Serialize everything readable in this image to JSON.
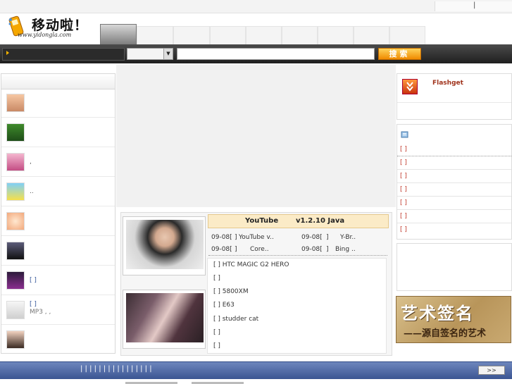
{
  "topbar": {
    "divider": "|"
  },
  "logo": {
    "title": "移动啦！",
    "url": "www.yidongla.com"
  },
  "search": {
    "button_label": "搜索",
    "select_arrow": "▼"
  },
  "left_list": [
    {
      "text": "",
      "text2": "",
      "blue": false
    },
    {
      "text": "",
      "text2": "",
      "blue": false
    },
    {
      "text": ",",
      "text2": "",
      "blue": false
    },
    {
      "text": "..",
      "text2": "",
      "blue": false
    },
    {
      "text": "",
      "text2": "",
      "blue": false
    },
    {
      "text": "",
      "text2": "",
      "blue": false
    },
    {
      "text": "[ ]",
      "text2": "",
      "blue": true
    },
    {
      "text": "[ ]",
      "text2": "MP3 ,   ,",
      "blue": true
    },
    {
      "text": "",
      "text2": "",
      "blue": false
    }
  ],
  "featured": {
    "title_a": "YouTube",
    "title_b": "v1.2.10 Java",
    "news": [
      {
        "date": "09-08[",
        "bracket": "]",
        "text": "YouTube    v.."
      },
      {
        "date": "09-08[",
        "bracket": "]",
        "text": "Y-Br.."
      },
      {
        "date": "09-08[",
        "bracket": "]",
        "text": "Core.."
      },
      {
        "date": "09-08[",
        "bracket": "]",
        "text": "Bing  .."
      }
    ],
    "list": [
      "[   ] HTC MAGIC G2  HERO",
      "[   ]",
      "[   ]    5800XM",
      "[   ]    E63",
      "[   ] studder cat",
      "[   ]",
      "[   ]"
    ]
  },
  "right": {
    "flashget_label": "Flashget",
    "rows": [
      "[ ]",
      "[ ]",
      "[ ]",
      "[ ]",
      "[ ]",
      "[ ]",
      "[ ]"
    ]
  },
  "banner": {
    "big": "艺术签名",
    "small": "——源自签名的艺术"
  },
  "bottom": {
    "pipes": "|     |     |     |     |     |     |     |     |     |     |     |     |     |     |     |",
    "more": ">>"
  }
}
